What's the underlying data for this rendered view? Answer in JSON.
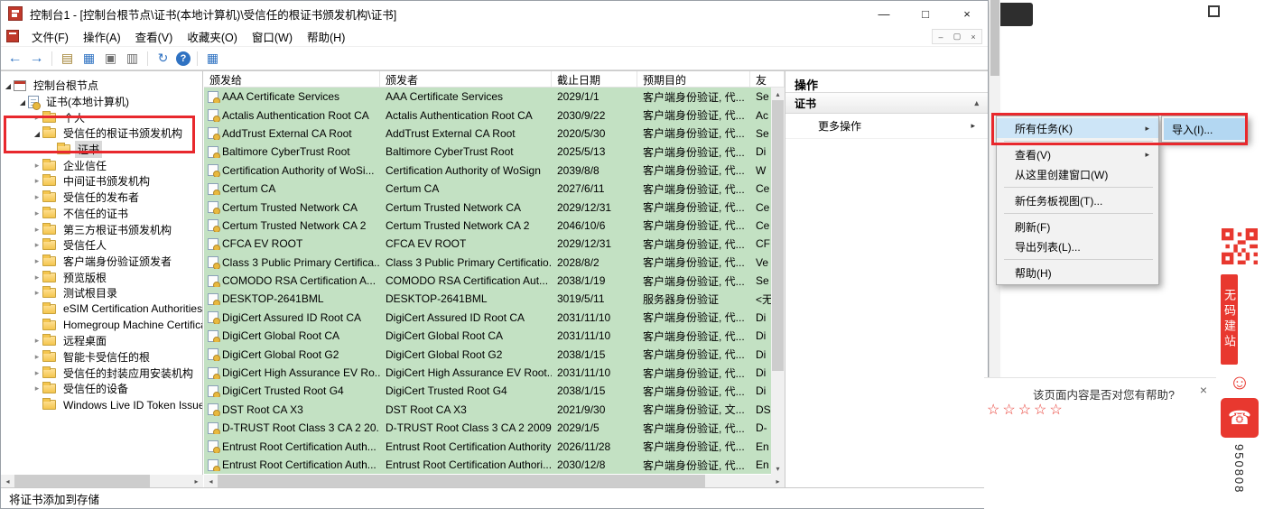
{
  "window": {
    "title": "控制台1 - [控制台根节点\\证书(本地计算机)\\受信任的根证书颁发机构\\证书]",
    "minimize": "—",
    "maximize": "□",
    "close": "×",
    "mdi_minimize": "–",
    "mdi_restore": "▢",
    "mdi_close": "×"
  },
  "menubar": {
    "items": [
      "文件(F)",
      "操作(A)",
      "查看(V)",
      "收藏夹(O)",
      "窗口(W)",
      "帮助(H)"
    ]
  },
  "toolbar": {
    "icons": [
      {
        "name": "back-icon",
        "glyph": "←"
      },
      {
        "name": "forward-icon",
        "glyph": "→"
      },
      {
        "name": "export-document-icon",
        "glyph": "▤"
      },
      {
        "name": "new-window-icon",
        "glyph": "▦"
      },
      {
        "name": "copy-icon",
        "glyph": "▣"
      },
      {
        "name": "properties-icon",
        "glyph": "▥"
      },
      {
        "name": "refresh-icon",
        "glyph": "↻"
      },
      {
        "name": "help-icon",
        "glyph": "?"
      },
      {
        "name": "view-grid-icon",
        "glyph": "▦"
      }
    ]
  },
  "icons": {
    "submenu_arrow": "▸",
    "collapse": "▴",
    "scroll_left": "◂",
    "scroll_right": "▸",
    "scroll_up": "▴",
    "scroll_down": "▾"
  },
  "tree": {
    "items": [
      {
        "label": "控制台根节点",
        "level": 0,
        "state": "expanded",
        "icon": "console"
      },
      {
        "label": "证书(本地计算机)",
        "level": 1,
        "state": "expanded",
        "icon": "cert"
      },
      {
        "label": "个人",
        "level": 2,
        "state": "collapsed",
        "icon": "folder"
      },
      {
        "label": "受信任的根证书颁发机构",
        "level": 2,
        "state": "expanded",
        "icon": "folder"
      },
      {
        "label": "证书",
        "level": 3,
        "state": "none",
        "icon": "folder",
        "selected": true
      },
      {
        "label": "企业信任",
        "level": 2,
        "state": "collapsed",
        "icon": "folder"
      },
      {
        "label": "中间证书颁发机构",
        "level": 2,
        "state": "collapsed",
        "icon": "folder"
      },
      {
        "label": "受信任的发布者",
        "level": 2,
        "state": "collapsed",
        "icon": "folder"
      },
      {
        "label": "不信任的证书",
        "level": 2,
        "state": "collapsed",
        "icon": "folder"
      },
      {
        "label": "第三方根证书颁发机构",
        "level": 2,
        "state": "collapsed",
        "icon": "folder"
      },
      {
        "label": "受信任人",
        "level": 2,
        "state": "collapsed",
        "icon": "folder"
      },
      {
        "label": "客户端身份验证颁发者",
        "level": 2,
        "state": "collapsed",
        "icon": "folder"
      },
      {
        "label": "预览版根",
        "level": 2,
        "state": "collapsed",
        "icon": "folder"
      },
      {
        "label": "测试根目录",
        "level": 2,
        "state": "collapsed",
        "icon": "folder"
      },
      {
        "label": "eSIM Certification Authorities",
        "level": 2,
        "state": "none",
        "icon": "folder"
      },
      {
        "label": "Homegroup Machine Certifica",
        "level": 2,
        "state": "none",
        "icon": "folder"
      },
      {
        "label": "远程桌面",
        "level": 2,
        "state": "collapsed",
        "icon": "folder"
      },
      {
        "label": "智能卡受信任的根",
        "level": 2,
        "state": "collapsed",
        "icon": "folder"
      },
      {
        "label": "受信任的封装应用安装机构",
        "level": 2,
        "state": "collapsed",
        "icon": "folder"
      },
      {
        "label": "受信任的设备",
        "level": 2,
        "state": "collapsed",
        "icon": "folder"
      },
      {
        "label": "Windows Live ID Token Issuer",
        "level": 2,
        "state": "none",
        "icon": "folder"
      }
    ]
  },
  "list": {
    "columns": [
      "颁发给",
      "颁发者",
      "截止日期",
      "预期目的",
      "友"
    ],
    "row_highlight_color": "#c3e1c3",
    "rows": [
      {
        "to": "AAA Certificate Services",
        "by": "AAA Certificate Services",
        "exp": "2029/1/1",
        "purpose": "客户端身份验证, 代...",
        "fr": "Se"
      },
      {
        "to": "Actalis Authentication Root CA",
        "by": "Actalis Authentication Root CA",
        "exp": "2030/9/22",
        "purpose": "客户端身份验证, 代...",
        "fr": "Ac"
      },
      {
        "to": "AddTrust External CA Root",
        "by": "AddTrust External CA Root",
        "exp": "2020/5/30",
        "purpose": "客户端身份验证, 代...",
        "fr": "Se"
      },
      {
        "to": "Baltimore CyberTrust Root",
        "by": "Baltimore CyberTrust Root",
        "exp": "2025/5/13",
        "purpose": "客户端身份验证, 代...",
        "fr": "Di"
      },
      {
        "to": "Certification Authority of WoSi...",
        "by": "Certification Authority of WoSign",
        "exp": "2039/8/8",
        "purpose": "客户端身份验证, 代...",
        "fr": "W"
      },
      {
        "to": "Certum CA",
        "by": "Certum CA",
        "exp": "2027/6/11",
        "purpose": "客户端身份验证, 代...",
        "fr": "Ce"
      },
      {
        "to": "Certum Trusted Network CA",
        "by": "Certum Trusted Network CA",
        "exp": "2029/12/31",
        "purpose": "客户端身份验证, 代...",
        "fr": "Ce"
      },
      {
        "to": "Certum Trusted Network CA 2",
        "by": "Certum Trusted Network CA 2",
        "exp": "2046/10/6",
        "purpose": "客户端身份验证, 代...",
        "fr": "Ce"
      },
      {
        "to": "CFCA EV ROOT",
        "by": "CFCA EV ROOT",
        "exp": "2029/12/31",
        "purpose": "客户端身份验证, 代...",
        "fr": "CF"
      },
      {
        "to": "Class 3 Public Primary Certifica...",
        "by": "Class 3 Public Primary Certificatio...",
        "exp": "2028/8/2",
        "purpose": "客户端身份验证, 代...",
        "fr": "Ve"
      },
      {
        "to": "COMODO RSA Certification A...",
        "by": "COMODO RSA Certification Aut...",
        "exp": "2038/1/19",
        "purpose": "客户端身份验证, 代...",
        "fr": "Se"
      },
      {
        "to": "DESKTOP-2641BML",
        "by": "DESKTOP-2641BML",
        "exp": "3019/5/11",
        "purpose": "服务器身份验证",
        "fr": "<无"
      },
      {
        "to": "DigiCert Assured ID Root CA",
        "by": "DigiCert Assured ID Root CA",
        "exp": "2031/11/10",
        "purpose": "客户端身份验证, 代...",
        "fr": "Di"
      },
      {
        "to": "DigiCert Global Root CA",
        "by": "DigiCert Global Root CA",
        "exp": "2031/11/10",
        "purpose": "客户端身份验证, 代...",
        "fr": "Di"
      },
      {
        "to": "DigiCert Global Root G2",
        "by": "DigiCert Global Root G2",
        "exp": "2038/1/15",
        "purpose": "客户端身份验证, 代...",
        "fr": "Di"
      },
      {
        "to": "DigiCert High Assurance EV Ro...",
        "by": "DigiCert High Assurance EV Root...",
        "exp": "2031/11/10",
        "purpose": "客户端身份验证, 代...",
        "fr": "Di"
      },
      {
        "to": "DigiCert Trusted Root G4",
        "by": "DigiCert Trusted Root G4",
        "exp": "2038/1/15",
        "purpose": "客户端身份验证, 代...",
        "fr": "Di"
      },
      {
        "to": "DST Root CA X3",
        "by": "DST Root CA X3",
        "exp": "2021/9/30",
        "purpose": "客户端身份验证, 文...",
        "fr": "DS"
      },
      {
        "to": "D-TRUST Root Class 3 CA 2 20...",
        "by": "D-TRUST Root Class 3 CA 2 2009",
        "exp": "2029/1/5",
        "purpose": "客户端身份验证, 代...",
        "fr": "D-"
      },
      {
        "to": "Entrust Root Certification Auth...",
        "by": "Entrust Root Certification Authority",
        "exp": "2026/11/28",
        "purpose": "客户端身份验证, 代...",
        "fr": "En"
      },
      {
        "to": "Entrust Root Certification Auth...",
        "by": "Entrust Root Certification Authori...",
        "exp": "2030/12/8",
        "purpose": "客户端身份验证, 代...",
        "fr": "En"
      }
    ]
  },
  "actions": {
    "title": "操作",
    "section_title": "证书",
    "more_actions": "更多操作"
  },
  "context_menu": {
    "items": [
      {
        "label": "所有任务(K)",
        "submenu": true,
        "highlighted": true
      },
      {
        "separator": true
      },
      {
        "label": "查看(V)",
        "submenu": true
      },
      {
        "label": "从这里创建窗口(W)"
      },
      {
        "separator": true
      },
      {
        "label": "新任务板视图(T)..."
      },
      {
        "separator": true
      },
      {
        "label": "刷新(F)"
      },
      {
        "label": "导出列表(L)..."
      },
      {
        "separator": true
      },
      {
        "label": "帮助(H)"
      }
    ]
  },
  "submenu": {
    "items": [
      {
        "label": "导入(I)...",
        "highlighted": true
      }
    ]
  },
  "statusbar": {
    "text": "将证书添加到存储"
  },
  "annotation": {
    "color": "#e8282d"
  },
  "side_panel": {
    "feedback_question": "该页面内容是否对您有帮助?",
    "close_icon": "×",
    "stars": "☆☆☆☆☆",
    "banner_vertical": "无码建站",
    "smiley_icon": "☺",
    "phone_icon": "☎",
    "service_number": "950808"
  }
}
